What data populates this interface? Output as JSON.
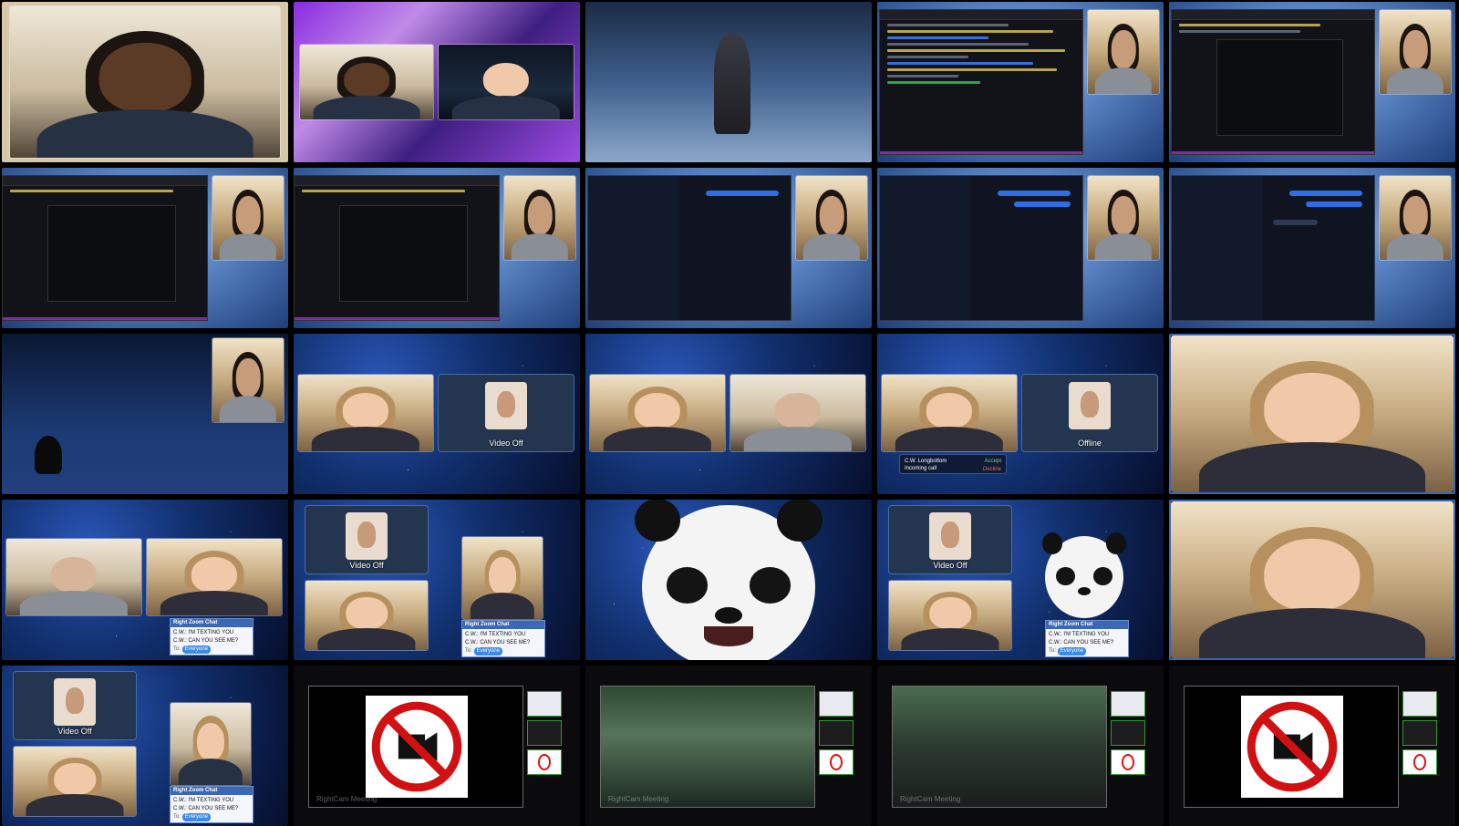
{
  "tiles": {
    "r3c2": {
      "label": "Video Off"
    },
    "r3c4": {
      "label": "Offline",
      "call": {
        "name": "C.W. Longbottom",
        "sub": "Incoming call",
        "accept": "Accept",
        "decline": "Decline"
      }
    },
    "r4c2": {
      "label": "Video Off"
    },
    "r4c4": {
      "label": "Video Off"
    },
    "r5c1": {
      "label": "Video Off"
    }
  },
  "chat": {
    "title": "Right Zoom Chat",
    "messages": [
      "C.W.: I'M TEXTING YOU",
      "C.W.: CAN YOU SEE ME?"
    ],
    "to_label": "To:",
    "to_value": "Everyone"
  },
  "watermark": "RightCam Meeting",
  "colors": {
    "accent": "#3c67b4",
    "purple_dock": "#7c2ea8",
    "green_highlight": "#2f9a2f",
    "no_video_red": "#d11111"
  }
}
